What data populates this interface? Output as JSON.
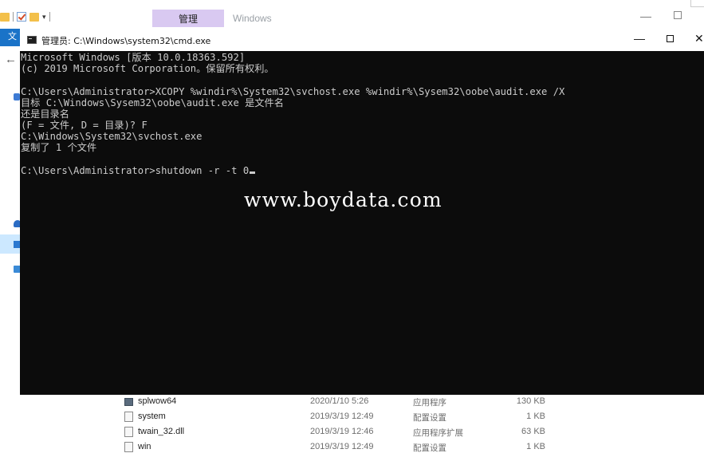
{
  "explorer": {
    "context_tab": "管理",
    "title": "Windows",
    "file_tab": "文件",
    "files": [
      {
        "name": "splwow64",
        "date": "2020/1/10 5:26",
        "type": "应用程序",
        "size": "130 KB",
        "icon": "application-icon"
      },
      {
        "name": "system",
        "date": "2019/3/19 12:49",
        "type": "配置设置",
        "size": "1 KB",
        "icon": "config-file-icon"
      },
      {
        "name": "twain_32.dll",
        "date": "2019/3/19 12:46",
        "type": "应用程序扩展",
        "size": "63 KB",
        "icon": "dll-file-icon"
      },
      {
        "name": "win",
        "date": "2019/3/19 12:49",
        "type": "配置设置",
        "size": "1 KB",
        "icon": "config-file-icon"
      }
    ]
  },
  "cmd": {
    "title": "管理员: C:\\Windows\\system32\\cmd.exe",
    "lines": [
      "Microsoft Windows [版本 10.0.18363.592]",
      "(c) 2019 Microsoft Corporation。保留所有权利。",
      "",
      "C:\\Users\\Administrator>XCOPY %windir%\\System32\\svchost.exe %windir%\\Sysem32\\oobe\\audit.exe /X",
      "目标 C:\\Windows\\Sysem32\\oobe\\audit.exe 是文件名",
      "还是目录名",
      "(F = 文件, D = 目录)? F",
      "C:\\Windows\\System32\\svchost.exe",
      "复制了 1 个文件",
      "",
      "C:\\Users\\Administrator>shutdown -r -t 0"
    ],
    "watermark": "www.boydata.com"
  },
  "colors": {
    "console_bg": "#0c0c0c",
    "console_text": "#cccccc",
    "ribbon_context": "#d9c9f1",
    "file_tab": "#1a73c8"
  }
}
